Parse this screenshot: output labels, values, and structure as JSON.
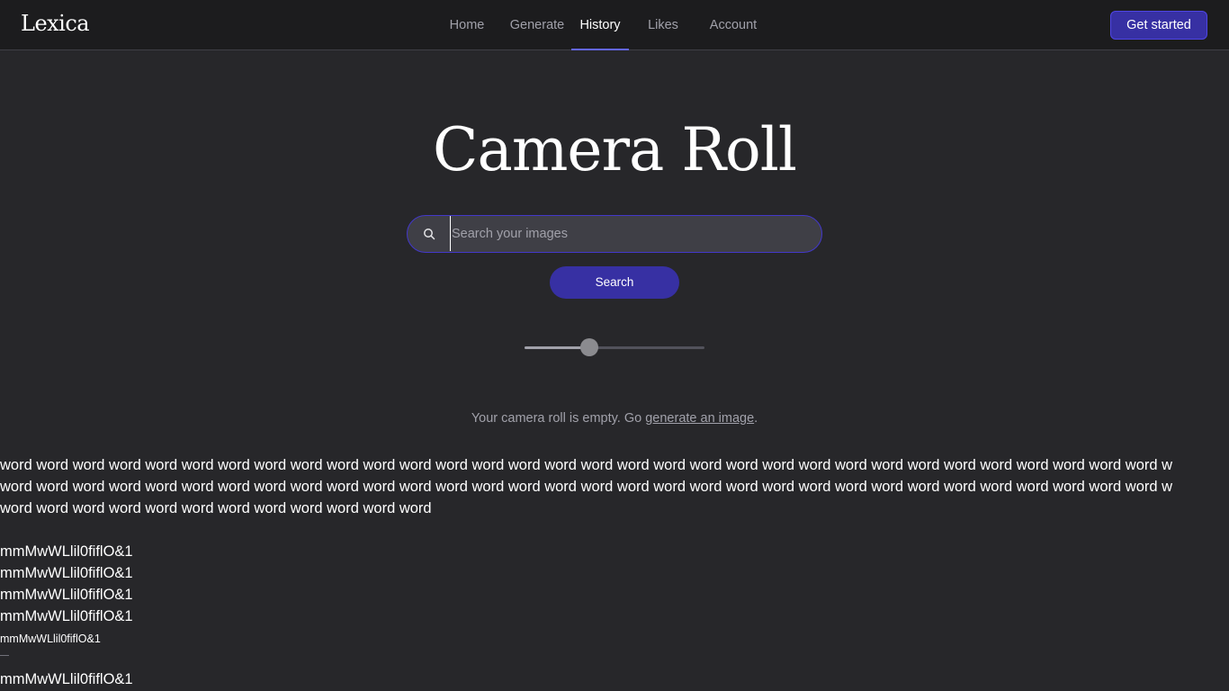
{
  "header": {
    "logo": "Lexica",
    "nav": [
      "Home",
      "Generate",
      "History",
      "Likes",
      "Account"
    ],
    "active_nav": "History",
    "cta": "Get started"
  },
  "main": {
    "title": "Camera Roll",
    "search": {
      "placeholder": "Search your images",
      "button": "Search"
    },
    "slider": {
      "value_fraction": 0.36
    },
    "empty": {
      "prefix": "Your camera roll is empty. Go ",
      "link": "generate an image",
      "suffix": "."
    }
  },
  "probe": {
    "line1": "word word word word word word word word word word word word word word word word word word word word word word word word word word word word word word word word w",
    "line2": "word word word word word word word word word word word word word word word word word word word word word word word word word word word word word word word word w",
    "line3": "word word word word word word word word word word word word",
    "glyphs": "mmMwWLlil0fiflO&1"
  },
  "colors": {
    "accent": "#4338ca",
    "background": "#27272a",
    "header": "#1c1c1e"
  }
}
